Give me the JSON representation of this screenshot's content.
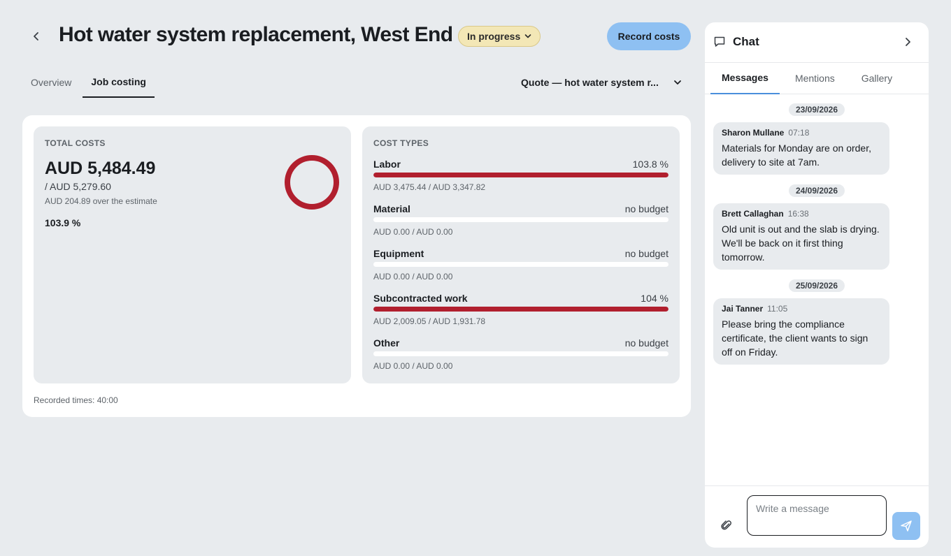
{
  "header": {
    "title": "Hot water system replacement, West End",
    "status": "In progress",
    "record_costs": "Record costs"
  },
  "tabs": [
    {
      "label": "Overview",
      "active": false
    },
    {
      "label": "Job costing",
      "active": true
    }
  ],
  "quote_select": {
    "value": "Quote — hot water system r..."
  },
  "total_costs": {
    "label": "TOTAL COSTS",
    "amount": "AUD 5,484.49",
    "budget": "/ AUD 5,279.60",
    "over": "AUD 204.89 over the estimate",
    "percent": "103.9 %",
    "ring_fraction": 1.0,
    "ring_color": "#b11f2e"
  },
  "cost_types": {
    "label": "COST TYPES",
    "items": [
      {
        "name": "Labor",
        "percent": "103.8 %",
        "fraction": 1.0,
        "amounts": "AUD 3,475.44 / AUD 3,347.82"
      },
      {
        "name": "Material",
        "percent": "no budget",
        "fraction": 0,
        "amounts": "AUD 0.00 / AUD 0.00"
      },
      {
        "name": "Equipment",
        "percent": "no budget",
        "fraction": 0,
        "amounts": "AUD 0.00 / AUD 0.00"
      },
      {
        "name": "Subcontracted work",
        "percent": "104 %",
        "fraction": 1.0,
        "amounts": "AUD 2,009.05 / AUD 1,931.78"
      },
      {
        "name": "Other",
        "percent": "no budget",
        "fraction": 0,
        "amounts": "AUD 0.00 / AUD 0.00"
      }
    ]
  },
  "recorded_times": "Recorded times: 40:00",
  "colors": {
    "over_budget": "#b11f2e",
    "accent": "#8ec0f2"
  },
  "chat": {
    "title": "Chat",
    "tabs": [
      {
        "label": "Messages",
        "active": true
      },
      {
        "label": "Mentions",
        "active": false
      },
      {
        "label": "Gallery",
        "active": false
      }
    ],
    "dates": [
      "23/09/2026",
      "24/09/2026",
      "25/09/2026"
    ],
    "messages": [
      {
        "author": "Sharon Mullane",
        "time": "07:18",
        "text": "Materials for Monday are on order, delivery to site at 7am."
      },
      {
        "author": "Brett Callaghan",
        "time": "16:38",
        "text": "Old unit is out and the slab is drying. We'll be back on it first thing tomorrow."
      },
      {
        "author": "Jai Tanner",
        "time": "11:05",
        "text": "Please bring the compliance certificate, the client wants to sign off on Friday."
      }
    ],
    "input_placeholder": "Write a message"
  },
  "icons": {
    "back": "chevron-left-icon",
    "status_dropdown": "chevron-down-icon",
    "quote_dropdown": "chevron-down-icon",
    "chat": "speech-bubble-icon",
    "chat_close": "chevron-right-icon",
    "attach": "paperclip-icon",
    "send": "paper-plane-icon"
  }
}
